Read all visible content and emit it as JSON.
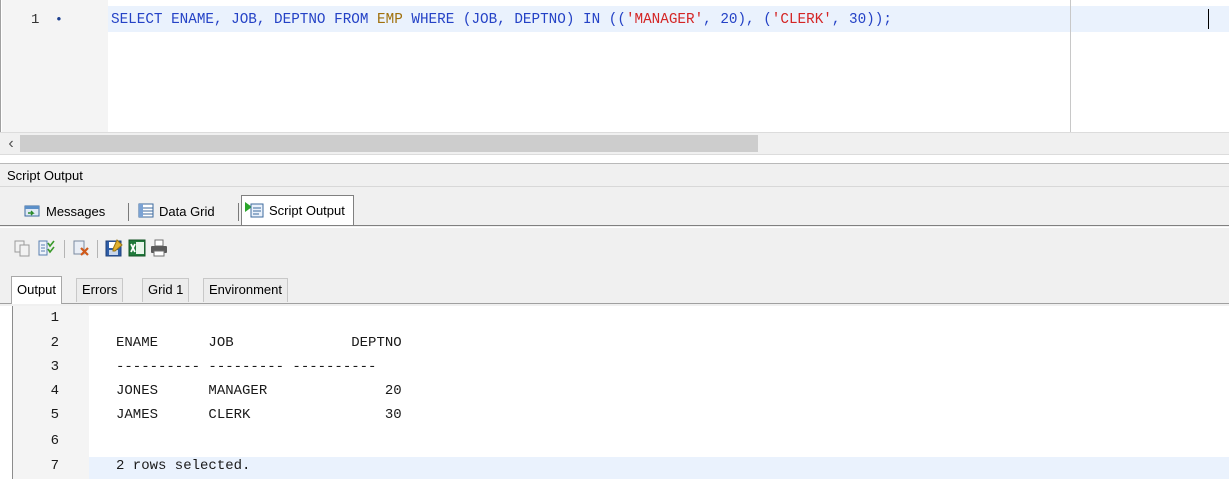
{
  "editor": {
    "line_number": "1",
    "line_marker": "•",
    "code_tokens": [
      {
        "text": "SELECT",
        "cls": "kw"
      },
      {
        "text": " ",
        "cls": "plain"
      },
      {
        "text": "ENAME, JOB, DEPTNO",
        "cls": "kw"
      },
      {
        "text": " ",
        "cls": "plain"
      },
      {
        "text": "FROM",
        "cls": "kw"
      },
      {
        "text": " ",
        "cls": "plain"
      },
      {
        "text": "EMP",
        "cls": "obj"
      },
      {
        "text": " ",
        "cls": "plain"
      },
      {
        "text": "WHERE",
        "cls": "kw"
      },
      {
        "text": " ",
        "cls": "plain"
      },
      {
        "text": "(JOB, DEPTNO)",
        "cls": "kw"
      },
      {
        "text": " ",
        "cls": "plain"
      },
      {
        "text": "IN",
        "cls": "kw"
      },
      {
        "text": " ((",
        "cls": "kw"
      },
      {
        "text": "'MANAGER'",
        "cls": "str"
      },
      {
        "text": ", 20), (",
        "cls": "kw"
      },
      {
        "text": "'CLERK'",
        "cls": "str"
      },
      {
        "text": ", 30));",
        "cls": "kw"
      }
    ]
  },
  "panel": {
    "title": "Script Output"
  },
  "result_tabs": [
    {
      "label": "Messages",
      "icon": "messages-icon"
    },
    {
      "label": "Data Grid",
      "icon": "data-grid-icon"
    },
    {
      "label": "Script Output",
      "icon": "script-output-icon",
      "active": true
    }
  ],
  "toolbar": {
    "buttons": [
      "copy-icon",
      "select-all-icon",
      "clear-icon",
      "save-icon",
      "excel-icon",
      "print-icon"
    ]
  },
  "output_tabs": [
    {
      "label": "Output",
      "active": true
    },
    {
      "label": "Errors"
    },
    {
      "label": "Grid 1"
    },
    {
      "label": "Environment"
    }
  ],
  "output_lines": [
    {
      "n": "1",
      "text": ""
    },
    {
      "n": "2",
      "text": "ENAME      JOB              DEPTNO"
    },
    {
      "n": "3",
      "text": "---------- --------- ----------"
    },
    {
      "n": "4",
      "text": "JONES      MANAGER              20"
    },
    {
      "n": "5",
      "text": "JAMES      CLERK                30"
    },
    {
      "n": "6",
      "text": ""
    },
    {
      "n": "7",
      "text": "2 rows selected."
    }
  ]
}
